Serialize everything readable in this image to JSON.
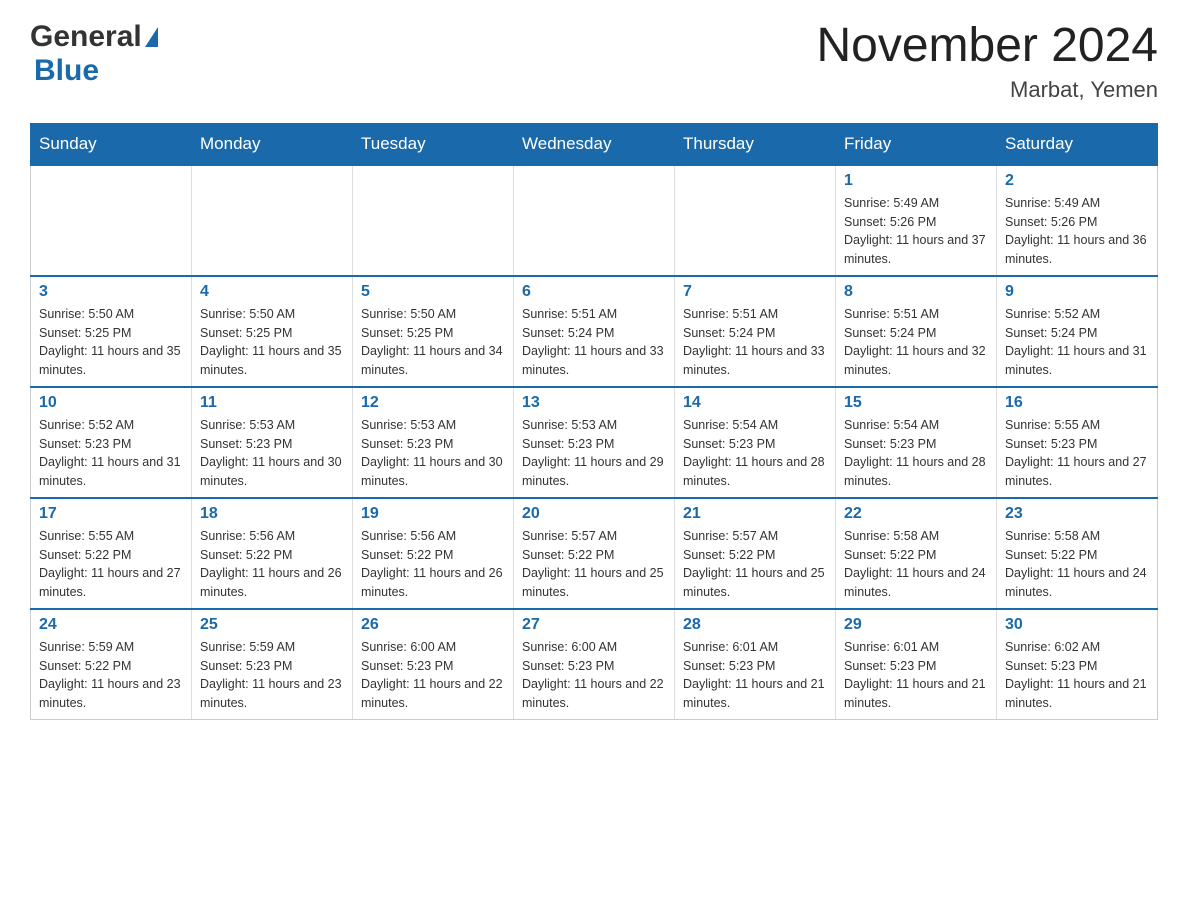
{
  "header": {
    "logo_general": "General",
    "logo_blue": "Blue",
    "title": "November 2024",
    "subtitle": "Marbat, Yemen"
  },
  "days_of_week": [
    "Sunday",
    "Monday",
    "Tuesday",
    "Wednesday",
    "Thursday",
    "Friday",
    "Saturday"
  ],
  "weeks": [
    [
      {
        "day": "",
        "info": ""
      },
      {
        "day": "",
        "info": ""
      },
      {
        "day": "",
        "info": ""
      },
      {
        "day": "",
        "info": ""
      },
      {
        "day": "",
        "info": ""
      },
      {
        "day": "1",
        "info": "Sunrise: 5:49 AM\nSunset: 5:26 PM\nDaylight: 11 hours and 37 minutes."
      },
      {
        "day": "2",
        "info": "Sunrise: 5:49 AM\nSunset: 5:26 PM\nDaylight: 11 hours and 36 minutes."
      }
    ],
    [
      {
        "day": "3",
        "info": "Sunrise: 5:50 AM\nSunset: 5:25 PM\nDaylight: 11 hours and 35 minutes."
      },
      {
        "day": "4",
        "info": "Sunrise: 5:50 AM\nSunset: 5:25 PM\nDaylight: 11 hours and 35 minutes."
      },
      {
        "day": "5",
        "info": "Sunrise: 5:50 AM\nSunset: 5:25 PM\nDaylight: 11 hours and 34 minutes."
      },
      {
        "day": "6",
        "info": "Sunrise: 5:51 AM\nSunset: 5:24 PM\nDaylight: 11 hours and 33 minutes."
      },
      {
        "day": "7",
        "info": "Sunrise: 5:51 AM\nSunset: 5:24 PM\nDaylight: 11 hours and 33 minutes."
      },
      {
        "day": "8",
        "info": "Sunrise: 5:51 AM\nSunset: 5:24 PM\nDaylight: 11 hours and 32 minutes."
      },
      {
        "day": "9",
        "info": "Sunrise: 5:52 AM\nSunset: 5:24 PM\nDaylight: 11 hours and 31 minutes."
      }
    ],
    [
      {
        "day": "10",
        "info": "Sunrise: 5:52 AM\nSunset: 5:23 PM\nDaylight: 11 hours and 31 minutes."
      },
      {
        "day": "11",
        "info": "Sunrise: 5:53 AM\nSunset: 5:23 PM\nDaylight: 11 hours and 30 minutes."
      },
      {
        "day": "12",
        "info": "Sunrise: 5:53 AM\nSunset: 5:23 PM\nDaylight: 11 hours and 30 minutes."
      },
      {
        "day": "13",
        "info": "Sunrise: 5:53 AM\nSunset: 5:23 PM\nDaylight: 11 hours and 29 minutes."
      },
      {
        "day": "14",
        "info": "Sunrise: 5:54 AM\nSunset: 5:23 PM\nDaylight: 11 hours and 28 minutes."
      },
      {
        "day": "15",
        "info": "Sunrise: 5:54 AM\nSunset: 5:23 PM\nDaylight: 11 hours and 28 minutes."
      },
      {
        "day": "16",
        "info": "Sunrise: 5:55 AM\nSunset: 5:23 PM\nDaylight: 11 hours and 27 minutes."
      }
    ],
    [
      {
        "day": "17",
        "info": "Sunrise: 5:55 AM\nSunset: 5:22 PM\nDaylight: 11 hours and 27 minutes."
      },
      {
        "day": "18",
        "info": "Sunrise: 5:56 AM\nSunset: 5:22 PM\nDaylight: 11 hours and 26 minutes."
      },
      {
        "day": "19",
        "info": "Sunrise: 5:56 AM\nSunset: 5:22 PM\nDaylight: 11 hours and 26 minutes."
      },
      {
        "day": "20",
        "info": "Sunrise: 5:57 AM\nSunset: 5:22 PM\nDaylight: 11 hours and 25 minutes."
      },
      {
        "day": "21",
        "info": "Sunrise: 5:57 AM\nSunset: 5:22 PM\nDaylight: 11 hours and 25 minutes."
      },
      {
        "day": "22",
        "info": "Sunrise: 5:58 AM\nSunset: 5:22 PM\nDaylight: 11 hours and 24 minutes."
      },
      {
        "day": "23",
        "info": "Sunrise: 5:58 AM\nSunset: 5:22 PM\nDaylight: 11 hours and 24 minutes."
      }
    ],
    [
      {
        "day": "24",
        "info": "Sunrise: 5:59 AM\nSunset: 5:22 PM\nDaylight: 11 hours and 23 minutes."
      },
      {
        "day": "25",
        "info": "Sunrise: 5:59 AM\nSunset: 5:23 PM\nDaylight: 11 hours and 23 minutes."
      },
      {
        "day": "26",
        "info": "Sunrise: 6:00 AM\nSunset: 5:23 PM\nDaylight: 11 hours and 22 minutes."
      },
      {
        "day": "27",
        "info": "Sunrise: 6:00 AM\nSunset: 5:23 PM\nDaylight: 11 hours and 22 minutes."
      },
      {
        "day": "28",
        "info": "Sunrise: 6:01 AM\nSunset: 5:23 PM\nDaylight: 11 hours and 21 minutes."
      },
      {
        "day": "29",
        "info": "Sunrise: 6:01 AM\nSunset: 5:23 PM\nDaylight: 11 hours and 21 minutes."
      },
      {
        "day": "30",
        "info": "Sunrise: 6:02 AM\nSunset: 5:23 PM\nDaylight: 11 hours and 21 minutes."
      }
    ]
  ]
}
